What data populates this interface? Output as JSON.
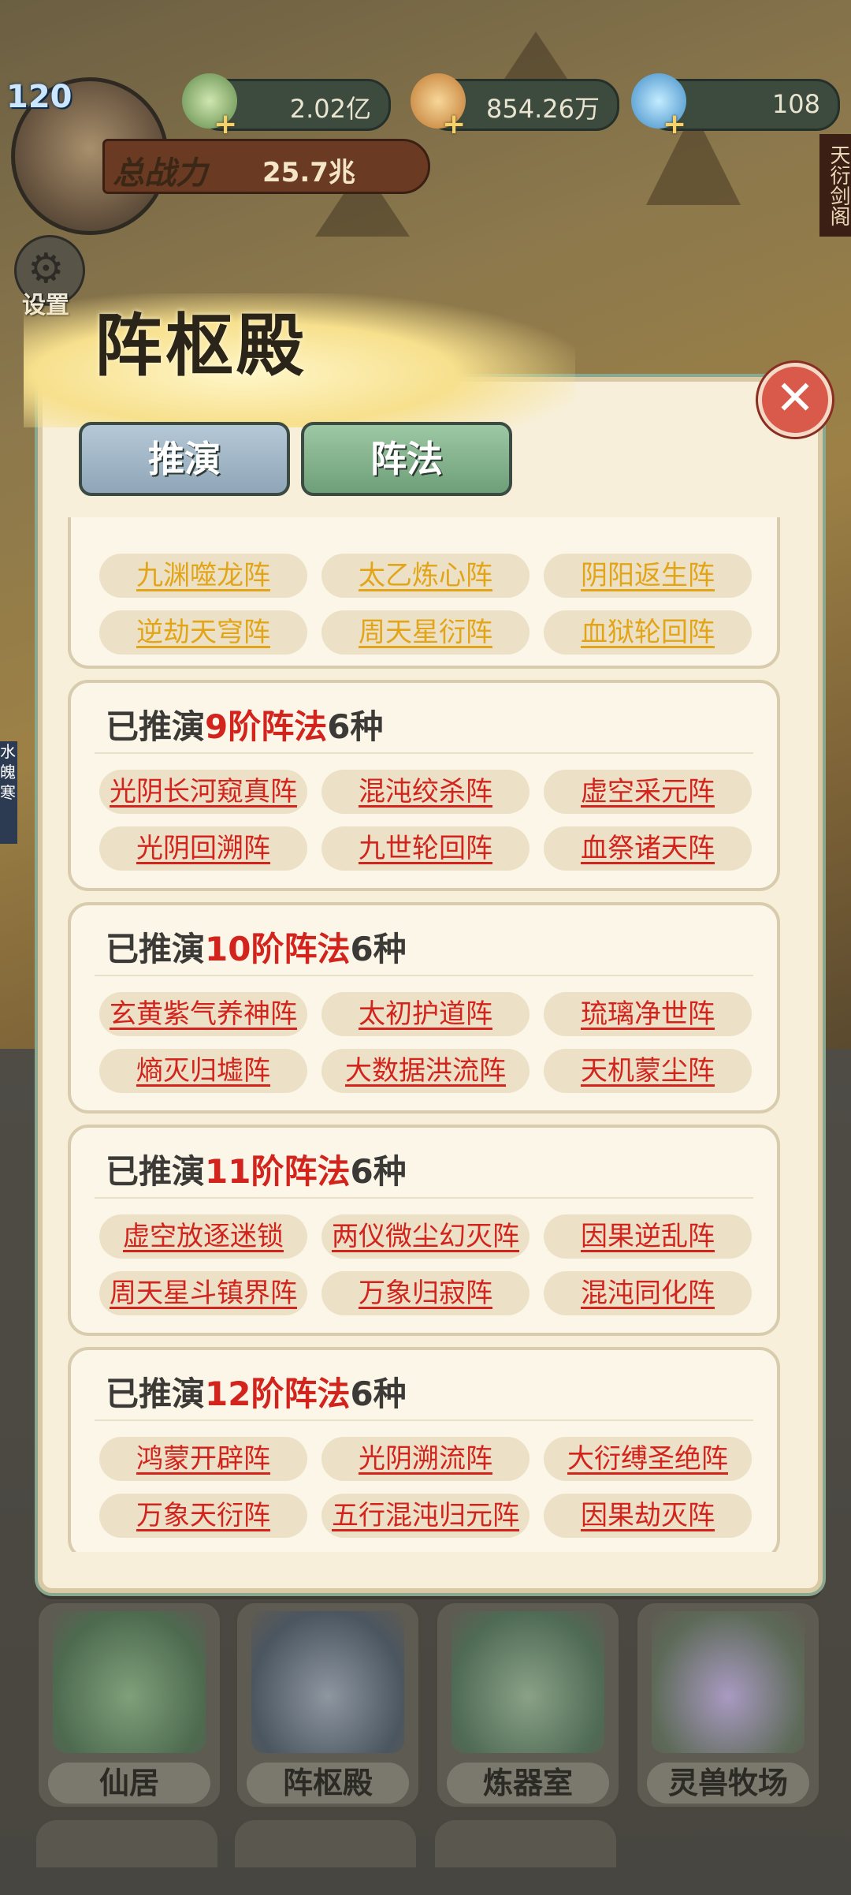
{
  "hud": {
    "level": "120",
    "resources": [
      {
        "icon": "jade-leaf-icon",
        "value": "2.02亿"
      },
      {
        "icon": "spirit-stone-icon",
        "value": "854.26万"
      },
      {
        "icon": "crystal-icon",
        "value": "108"
      }
    ],
    "power_label": "总战力",
    "power_value": "25.7兆",
    "settings_label": "设置",
    "side_title": "天衍剑阁",
    "left_strip": "水魄寒"
  },
  "panel": {
    "title": "阵枢殿",
    "tabs": [
      {
        "label": "推演",
        "active": false
      },
      {
        "label": "阵法",
        "active": true
      }
    ],
    "top_chips": [
      "九渊噬龙阵",
      "太乙炼心阵",
      "阴阳返生阵",
      "逆劫天穹阵",
      "周天星衍阵",
      "血狱轮回阵"
    ],
    "sections": [
      {
        "prefix": "已推演",
        "tier": "9阶阵法",
        "count": "6种",
        "items": [
          "光阴长河窥真阵",
          "混沌绞杀阵",
          "虚空采元阵",
          "光阴回溯阵",
          "九世轮回阵",
          "血祭诸天阵"
        ]
      },
      {
        "prefix": "已推演",
        "tier": "10阶阵法",
        "count": "6种",
        "items": [
          "玄黄紫气养神阵",
          "太初护道阵",
          "琉璃净世阵",
          "熵灭归墟阵",
          "大数据洪流阵",
          "天机蒙尘阵"
        ]
      },
      {
        "prefix": "已推演",
        "tier": "11阶阵法",
        "count": "6种",
        "items": [
          "虚空放逐迷锁",
          "两仪微尘幻灭阵",
          "因果逆乱阵",
          "周天星斗镇界阵",
          "万象归寂阵",
          "混沌同化阵"
        ]
      },
      {
        "prefix": "已推演",
        "tier": "12阶阵法",
        "count": "6种",
        "items": [
          "鸿蒙开辟阵",
          "光阴溯流阵",
          "大衍缚圣绝阵",
          "万象天衍阵",
          "五行混沌归元阵",
          "因果劫灭阵"
        ]
      }
    ],
    "colors": {
      "gold": "#e3a518",
      "red": "#d3231d"
    }
  },
  "buildings": [
    "仙居",
    "阵枢殿",
    "炼器室",
    "灵兽牧场"
  ]
}
